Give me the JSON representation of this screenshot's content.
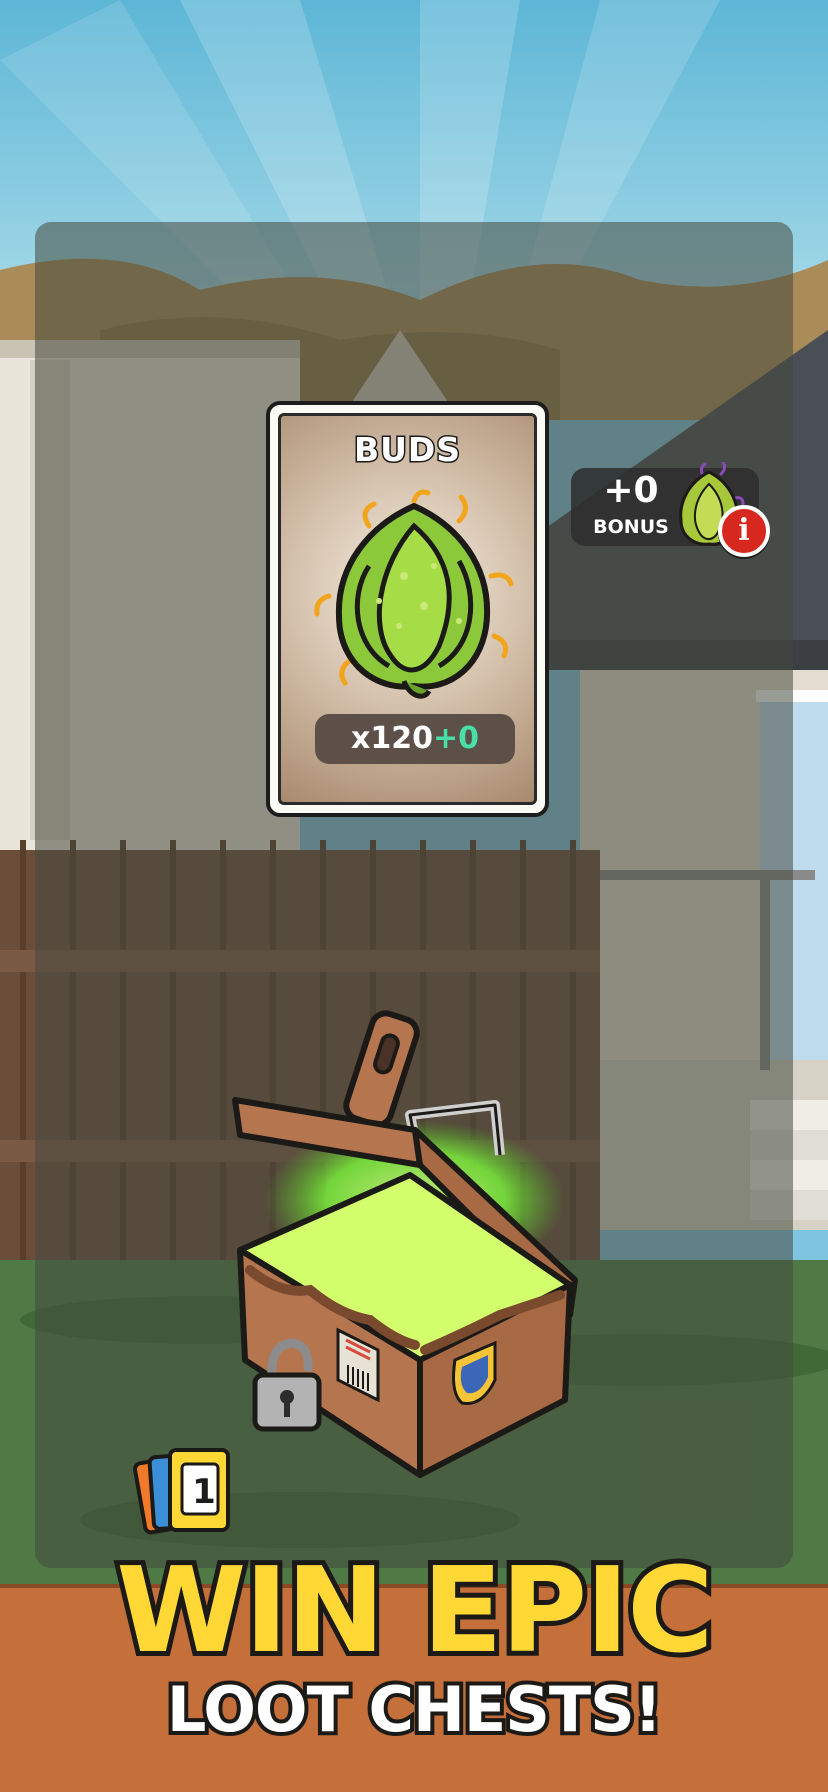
{
  "reward_card": {
    "title": "BUDS",
    "quantity": "x120",
    "bonus_quantity": "+0",
    "icon": "bud-icon"
  },
  "bonus_indicator": {
    "value": "+0",
    "label": "BONUS",
    "icon": "bud-icon",
    "info_icon": "info-icon",
    "info_glyph": "i"
  },
  "card_counter": {
    "count": "1",
    "icon": "cards-stack-icon"
  },
  "loot_chest": {
    "icon": "open-chest-icon"
  },
  "promo": {
    "line1": "WIN EPIC",
    "line2": "LOOT CHESTS!"
  },
  "colors": {
    "promo_text": "#ffd836",
    "bonus_qty": "#48e0a8",
    "banner": "#c56f3b",
    "chest_glow": "#7dff3a"
  }
}
